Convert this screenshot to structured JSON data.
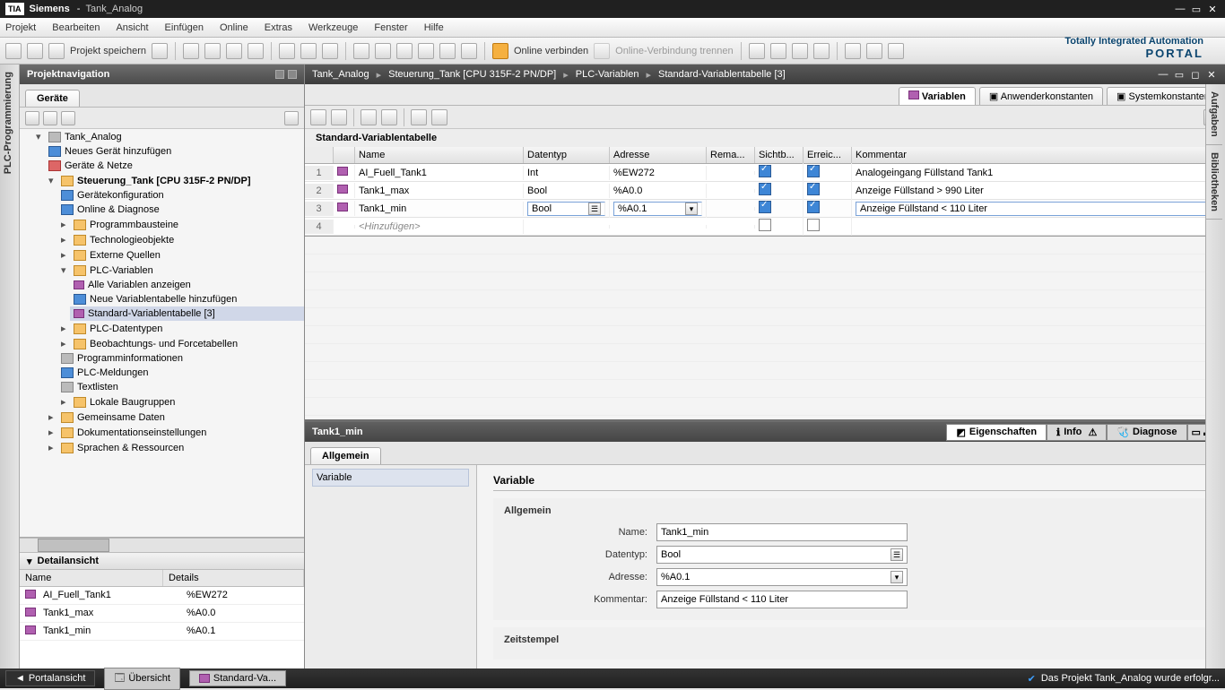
{
  "title": {
    "logo": "TIA",
    "brand": "Siemens",
    "project": "Tank_Analog"
  },
  "menu": [
    "Projekt",
    "Bearbeiten",
    "Ansicht",
    "Einfügen",
    "Online",
    "Extras",
    "Werkzeuge",
    "Fenster",
    "Hilfe"
  ],
  "branding": {
    "line": "Totally Integrated Automation",
    "portal": "PORTAL"
  },
  "toolbar": {
    "save": "Projekt speichern",
    "online": "Online verbinden",
    "offline": "Online-Verbindung trennen"
  },
  "leftrail": "PLC-Programmierung",
  "nav": {
    "title": "Projektnavigation",
    "tab": "Geräte",
    "tree": {
      "root": "Tank_Analog",
      "add_device": "Neues Gerät hinzufügen",
      "networks": "Geräte & Netze",
      "cpu": "Steuerung_Tank [CPU 315F-2 PN/DP]",
      "devconf": "Gerätekonfiguration",
      "onlinediag": "Online & Diagnose",
      "progblocks": "Programmbausteine",
      "techobj": "Technologieobjekte",
      "extsrc": "Externe Quellen",
      "plcvars": "PLC-Variablen",
      "allvars": "Alle Variablen anzeigen",
      "newtable": "Neue Variablentabelle hinzufügen",
      "stdtable": "Standard-Variablentabelle [3]",
      "plctypes": "PLC-Datentypen",
      "watchforce": "Beobachtungs- und Forcetabellen",
      "proginfo": "Programminformationen",
      "plcmsgs": "PLC-Meldungen",
      "textlists": "Textlisten",
      "localmods": "Lokale Baugruppen",
      "common": "Gemeinsame Daten",
      "docset": "Dokumentationseinstellungen",
      "langres": "Sprachen & Ressourcen"
    }
  },
  "detail": {
    "title": "Detailansicht",
    "cols": [
      "Name",
      "Details"
    ],
    "rows": [
      {
        "name": "AI_Fuell_Tank1",
        "details": "%EW272"
      },
      {
        "name": "Tank1_max",
        "details": "%A0.0"
      },
      {
        "name": "Tank1_min",
        "details": "%A0.1"
      }
    ]
  },
  "breadcrumb": [
    "Tank_Analog",
    "Steuerung_Tank [CPU 315F-2 PN/DP]",
    "PLC-Variablen",
    "Standard-Variablentabelle [3]"
  ],
  "righttabs": {
    "vars": "Variablen",
    "userconst": "Anwenderkonstanten",
    "sysconst": "Systemkonstanten"
  },
  "table": {
    "title": "Standard-Variablentabelle",
    "cols": {
      "name": "Name",
      "type": "Datentyp",
      "addr": "Adresse",
      "rem": "Rema...",
      "vis": "Sichtb...",
      "acc": "Erreic...",
      "com": "Kommentar"
    },
    "rows": [
      {
        "n": "1",
        "name": "AI_Fuell_Tank1",
        "type": "Int",
        "addr": "%EW272",
        "vis": true,
        "acc": true,
        "com": "Analogeingang Füllstand Tank1"
      },
      {
        "n": "2",
        "name": "Tank1_max",
        "type": "Bool",
        "addr": "%A0.0",
        "vis": true,
        "acc": true,
        "com": "Anzeige Füllstand > 990 Liter"
      },
      {
        "n": "3",
        "name": "Tank1_min",
        "type": "Bool",
        "addr": "%A0.1",
        "vis": true,
        "acc": true,
        "com": "Anzeige Füllstand < 110 Liter"
      }
    ],
    "addrow": {
      "n": "4",
      "placeholder": "<Hinzufügen>"
    }
  },
  "inspector": {
    "title": "Tank1_min",
    "tabs": {
      "props": "Eigenschaften",
      "info": "Info",
      "diag": "Diagnose"
    },
    "subtab": "Allgemein",
    "sideitem": "Variable",
    "h3": "Variable",
    "section": "Allgemein",
    "fields": {
      "name": {
        "label": "Name:",
        "value": "Tank1_min"
      },
      "type": {
        "label": "Datentyp:",
        "value": "Bool"
      },
      "addr": {
        "label": "Adresse:",
        "value": "%A0.1"
      },
      "com": {
        "label": "Kommentar:",
        "value": "Anzeige Füllstand < 110 Liter"
      }
    },
    "timestamp": "Zeitstempel"
  },
  "sidepanels": {
    "tasks": "Aufgaben",
    "libs": "Bibliotheken"
  },
  "status": {
    "portal": "Portalansicht",
    "overview": "Übersicht",
    "stdva": "Standard-Va...",
    "msg": "Das Projekt Tank_Analog wurde erfolgr..."
  }
}
